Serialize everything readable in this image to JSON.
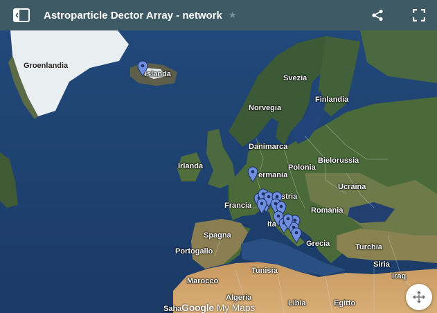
{
  "header": {
    "title": "Astroparticle Dector Array - network",
    "icons": {
      "menu": "sidebar-toggle-icon",
      "star": "star-icon",
      "share": "share-icon",
      "fullscreen": "fullscreen-icon"
    },
    "star_glyph": "★",
    "background": "#3e5a64"
  },
  "map": {
    "labels": {
      "groenlandia": "Groenlandia",
      "islanda": "Islanda",
      "svezia": "Svezia",
      "finlandia": "Finlandia",
      "norvegia": "Norvegia",
      "danimarca": "Danimarca",
      "irlanda": "Irlanda",
      "germania": "ermania",
      "polonia": "Polonia",
      "bielorussia": "Bielorussia",
      "ucraina": "Ucraina",
      "francia": "Francia",
      "austria": "stria",
      "romania": "Romania",
      "italia": "Ita",
      "spagna": "Spagna",
      "portogallo": "Portogallo",
      "grecia": "Grecia",
      "turchia": "Turchia",
      "tunisia": "Tunisia",
      "siria": "Siria",
      "iraq": "Iraq",
      "marocco": "Marocco",
      "algeria": "Algeria",
      "libia": "Libia",
      "egitto": "Egitto",
      "sahara": "Saha"
    },
    "pin_color": "#6e8edf",
    "pin_count": 16
  },
  "watermark": {
    "google": "Google",
    "mymaps": " My Maps"
  },
  "controls": {
    "recenter_icon": "recenter-arrows-icon"
  }
}
